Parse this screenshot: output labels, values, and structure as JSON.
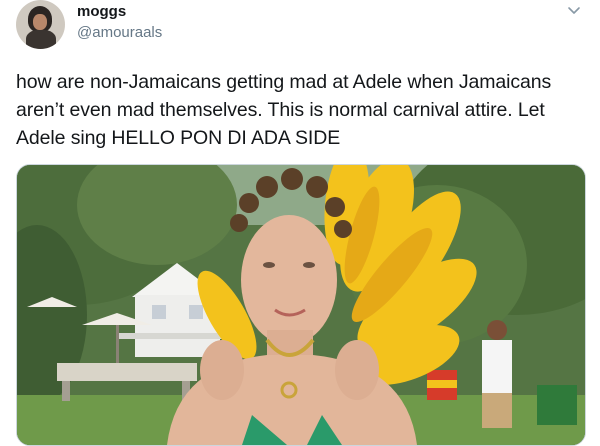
{
  "tweet": {
    "display_name": "moggs",
    "handle": "@amouraals",
    "text": "how are non-Jamaicans getting mad at Adele when Jamaicans aren’t even mad themselves. This is normal carnival attire. Let Adele sing HELLO PON DI ADA SIDE"
  },
  "icons": {
    "menu": "chevron-down-icon",
    "avatar": "avatar-image"
  },
  "colors": {
    "text": "#14171a",
    "secondary": "#657786",
    "border": "#ccd6dd",
    "feather_yellow": "#f3c21c"
  }
}
